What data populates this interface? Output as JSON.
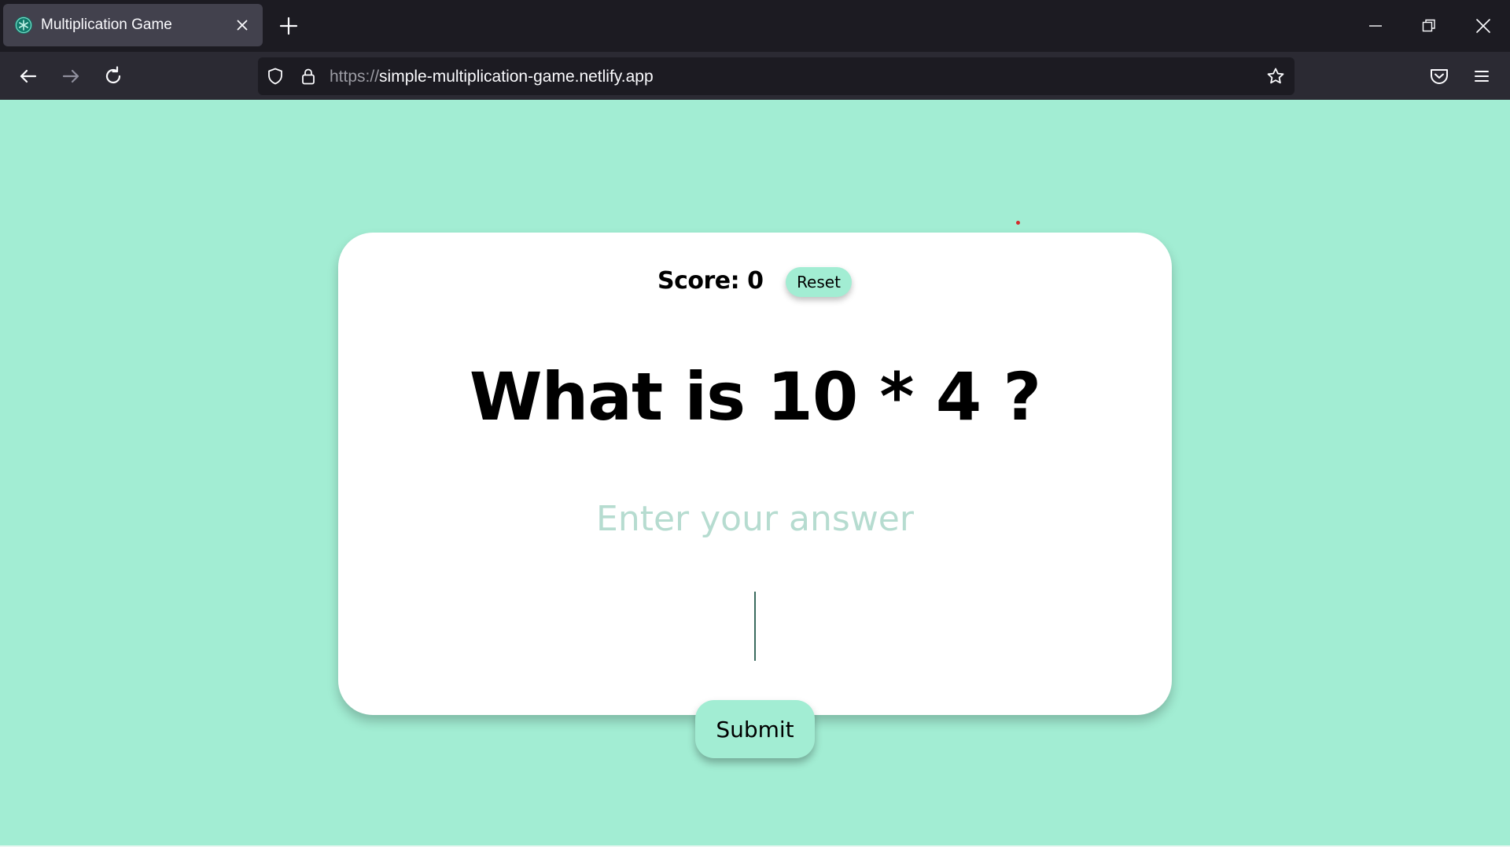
{
  "browser": {
    "tab": {
      "title": "Multiplication Game",
      "favicon": "snowflake-icon"
    },
    "url": {
      "protocol": "https://",
      "host": "simple-multiplication-game.netlify.app"
    },
    "icons": {
      "back": "arrow-left-icon",
      "forward": "arrow-right-icon",
      "reload": "reload-icon",
      "tracking": "shield-icon",
      "lock": "lock-icon",
      "bookmark": "star-icon",
      "pocket": "pocket-icon",
      "menu": "hamburger-menu-icon"
    }
  },
  "game": {
    "score_label": "Score: 0",
    "reset_label": "Reset",
    "question": "What is 10 * 4 ?",
    "answer_placeholder": "Enter your answer",
    "answer_value": "",
    "submit_label": "Submit"
  },
  "colors": {
    "page_background": "#a2edd3",
    "button_background": "#a2edd3",
    "card_background": "#ffffff",
    "placeholder": "#b6dcd0"
  }
}
